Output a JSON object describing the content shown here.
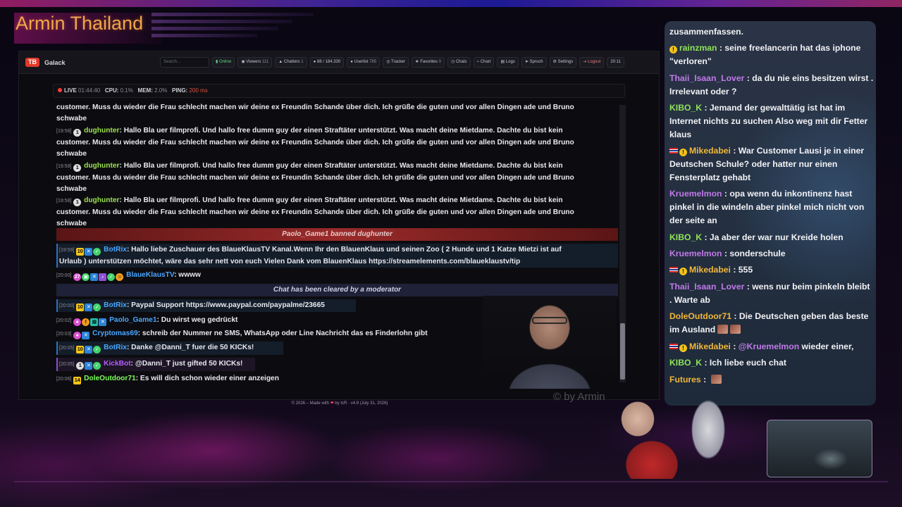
{
  "channel_title": "Armin Thailand",
  "nav": {
    "logo": "TB",
    "brand": "Galack",
    "search_placeholder": "Search...",
    "buttons": [
      {
        "label": "Online",
        "count": ""
      },
      {
        "label": "Viewers",
        "count": "111"
      },
      {
        "label": "Chatters",
        "count": "1"
      },
      {
        "label": "",
        "count": "88 / 184.330"
      },
      {
        "label": "Userlist",
        "count": "785"
      },
      {
        "label": "Tracker",
        "count": ""
      },
      {
        "label": "Favorites",
        "count": "0"
      },
      {
        "label": "Chats",
        "count": ""
      },
      {
        "label": "Chart",
        "count": ""
      },
      {
        "label": "Logs",
        "count": ""
      },
      {
        "label": "Spruch",
        "count": ""
      },
      {
        "label": "Settings",
        "count": ""
      },
      {
        "label": "Logout",
        "count": ""
      },
      {
        "label": "20:11",
        "count": ""
      }
    ]
  },
  "status": {
    "live": "LIVE",
    "uptime": "01:44:40",
    "cpu_label": "CPU:",
    "cpu": "0.1%",
    "mem_label": "MEM:",
    "mem": "2.0%",
    "ping_label": "PING:",
    "ping": "200 ms"
  },
  "chat": {
    "first_cont": "customer. Muss du wieder die Frau schlecht machen wir deine ex Freundin Schande über dich. Ich grüße die guten und vor allen Dingen ade und Bruno",
    "first_cont2": "schwabe",
    "repeat_msg": {
      "ts": "[19:58]",
      "badge": "1",
      "user": "dughunter",
      "line1": ": Hallo Bla uer filmprofi. Und hallo free dumm guy der einen Straftäter unterstützt. Was macht deine Mietdame. Dachte du bist kein",
      "line2": "customer. Muss du wieder die Frau schlecht machen wir deine ex Freundin Schande über dich. Ich grüße die guten und vor allen Dingen ade und Bruno",
      "line3": "schwabe"
    },
    "ban_notice": "Paolo_Game1 banned dughunter",
    "botrix1": {
      "ts": "[19:59]",
      "badge": "10",
      "user": "BotRix",
      "line1": ": Hallo liebe Zuschauer des BlaueKlausTV Kanal.Wenn Ihr den BlauenKlaus und seinen Zoo ( 2 Hunde und 1 Katze Mietzi ist auf",
      "line2": "Urlaub ) unterstützen möchtet, wäre das sehr nett von euch Vielen Dank vom BlauenKlaus https://streamelements.com/blaueklaustv/tip"
    },
    "blaue": {
      "ts": "[20:00]",
      "badge": "27",
      "user": "BlaueKlausTV",
      "text": ": wwww"
    },
    "clear_notice": "Chat has been cleared by a moderator",
    "botrix2": {
      "ts": "[20:00]",
      "badge": "10",
      "user": "BotRix",
      "text": ": Paypal Support https://www.paypal.com/paypalme/23665"
    },
    "paolo": {
      "ts": "[20:02]",
      "user": "Paolo_Game1",
      "text": ": Du wirst weg gedrückt"
    },
    "crypto": {
      "ts": "[20:03]",
      "user": "Cryptomas69",
      "text": ": schreib der Nummer ne SMS, WhatsApp oder Line Nachricht das es Finderlohn gibt"
    },
    "botrix3": {
      "ts": "[20:05]",
      "badge": "10",
      "user": "BotRix",
      "text": ": Danke @Danni_T fuer die 50 KICKs!"
    },
    "kickbot": {
      "ts": "[20:05]",
      "badge": "1",
      "user": "KickBot",
      "text": ": @Danni_T just gifted 50 KICKs!"
    },
    "dole": {
      "ts": "[20:06]",
      "badge": "14",
      "user": "DoleOutdoor71",
      "text": ": Es will dich schon wieder einer anzeigen"
    }
  },
  "footer": {
    "left": "© 2026 – Made with",
    "heart": "❤",
    "right": "by tcR · v4.9 (July 31, 2026)"
  },
  "watermark": "© by Armin",
  "overlay": [
    {
      "user": "",
      "text": "zusammenfassen."
    },
    {
      "user": "rainzman",
      "text": ": seine freelancerin hat das iphone \"verloren\""
    },
    {
      "user": "Thaii_Isaan_Lover",
      "text": ": da du nie eins besitzen wirst . Irrelevant oder ?"
    },
    {
      "user": "KIBO_K",
      "text": ": Jemand der gewalttätig ist hat im Internet nichts zu suchen Also weg mit dir Fetter klaus"
    },
    {
      "user": "Mikedabei",
      "text": ": War Customer Lausi je in einer Deutschen Schule? oder hatter nur einen Fensterplatz gehabt"
    },
    {
      "user": "Kruemelmon",
      "text": ": opa wenn du inkontinenz hast pinkel in die windeln aber pinkel mich nicht von der seite an"
    },
    {
      "user": "KIBO_K",
      "text": ": Ja aber der war nur Kreide holen"
    },
    {
      "user": "Kruemelmon",
      "text": ": sonderschule"
    },
    {
      "user": "Mikedabei",
      "text": ": 555"
    },
    {
      "user": "Thaii_Isaan_Lover",
      "text": ": wens nur beim pinkeln bleibt . Warte ab"
    },
    {
      "user": "DoleOutdoor71",
      "text": ": Die Deutschen geben das beste im Ausland"
    },
    {
      "user": "Mikedabei",
      "text": ": ",
      "mention": "@Kruemelmon",
      "after": " wieder einer,"
    },
    {
      "user": "KIBO_K",
      "text": ": Ich liebe euch chat"
    },
    {
      "user": "Futures",
      "text": ": "
    }
  ]
}
